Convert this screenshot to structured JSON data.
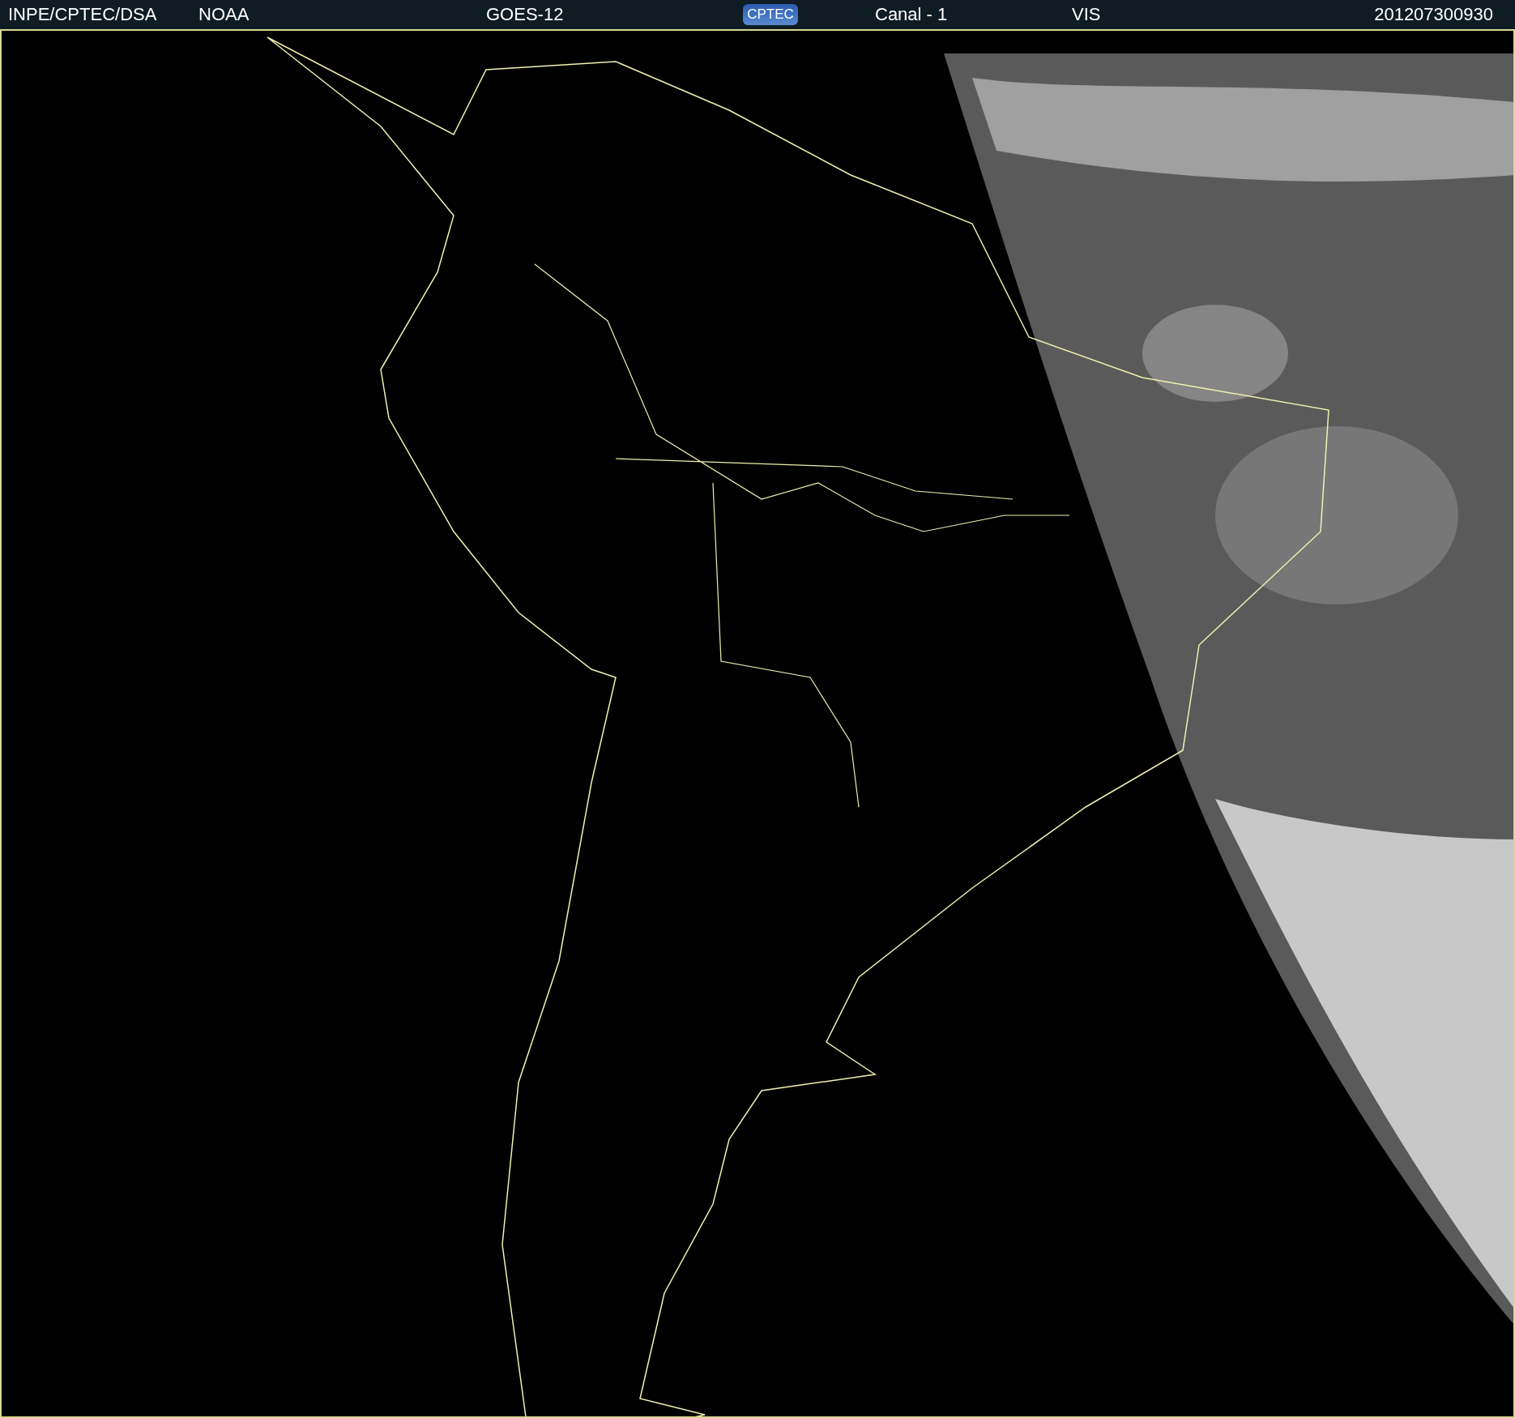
{
  "header": {
    "institution": "INPE/CPTEC/DSA",
    "agency": "NOAA",
    "satellite": "GOES-12",
    "logo": "CPTEC",
    "channel": "Canal - 1",
    "band": "VIS",
    "timestamp": "201207300930"
  }
}
